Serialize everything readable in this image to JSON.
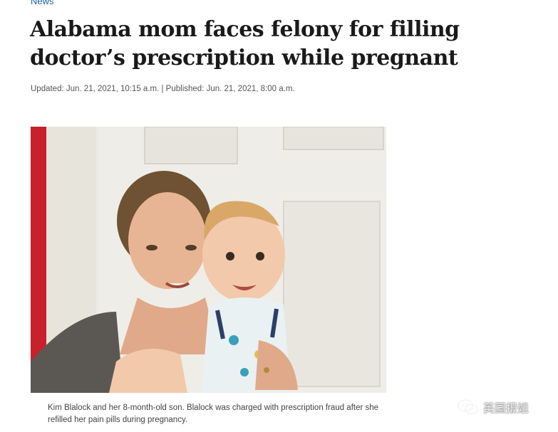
{
  "section": {
    "label": "News"
  },
  "article": {
    "headline": "Alabama mom faces felony for filling doctor’s prescription while pregnant",
    "dateline": "Updated: Jun. 21, 2021, 10:15 a.m. | Published: Jun. 21, 2021, 8:00 a.m.",
    "photo": {
      "icon": "photo-mother-and-baby"
    },
    "caption": "Kim Blalock and her 8-month-old son. Blalock was charged with prescription fraud after she refilled her pain pills during pregnancy."
  },
  "watermark": {
    "icon": "wechat-icon",
    "text": "英国报姐"
  },
  "colors": {
    "link": "#1f5fa8",
    "headline": "#1a1a1a",
    "door_red": "#c8212a"
  }
}
